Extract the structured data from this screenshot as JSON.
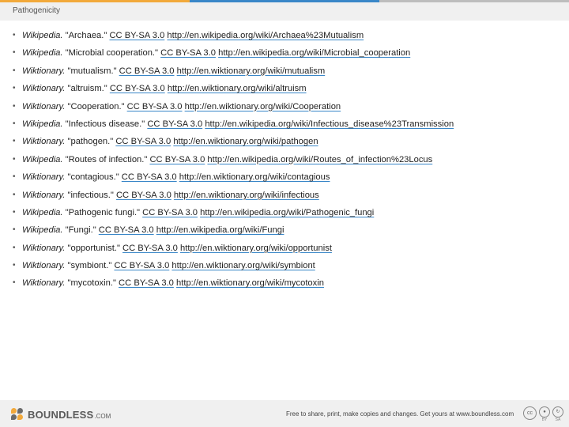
{
  "header": {
    "title": "Pathogenicity"
  },
  "references": [
    {
      "source": "Wikipedia.",
      "text": " \"Archaea.\" ",
      "license": "CC BY-SA 3.0",
      "url": "http://en.wikipedia.org/wiki/Archaea%23Mutualism"
    },
    {
      "source": "Wikipedia.",
      "text": " \"Microbial cooperation.\" ",
      "license": "CC BY-SA 3.0",
      "url": "http://en.wikipedia.org/wiki/Microbial_cooperation"
    },
    {
      "source": "Wiktionary.",
      "text": " \"mutualism.\" ",
      "license": "CC BY-SA 3.0",
      "url": "http://en.wiktionary.org/wiki/mutualism"
    },
    {
      "source": "Wiktionary.",
      "text": " \"altruism.\" ",
      "license": "CC BY-SA 3.0",
      "url": "http://en.wiktionary.org/wiki/altruism"
    },
    {
      "source": "Wiktionary.",
      "text": " \"Cooperation.\" ",
      "license": "CC BY-SA 3.0",
      "url": "http://en.wiktionary.org/wiki/Cooperation"
    },
    {
      "source": "Wikipedia.",
      "text": " \"Infectious disease.\" ",
      "license": "CC BY-SA 3.0",
      "url": "http://en.wikipedia.org/wiki/Infectious_disease%23Transmission"
    },
    {
      "source": "Wiktionary.",
      "text": " \"pathogen.\" ",
      "license": "CC BY-SA 3.0",
      "url": "http://en.wiktionary.org/wiki/pathogen"
    },
    {
      "source": "Wikipedia.",
      "text": " \"Routes of infection.\" ",
      "license": "CC BY-SA 3.0",
      "url": "http://en.wikipedia.org/wiki/Routes_of_infection%23Locus"
    },
    {
      "source": "Wiktionary.",
      "text": " \"contagious.\" ",
      "license": "CC BY-SA 3.0",
      "url": "http://en.wiktionary.org/wiki/contagious"
    },
    {
      "source": "Wiktionary.",
      "text": " \"infectious.\" ",
      "license": "CC BY-SA 3.0",
      "url": "http://en.wiktionary.org/wiki/infectious"
    },
    {
      "source": "Wikipedia.",
      "text": " \"Pathogenic fungi.\" ",
      "license": "CC BY-SA 3.0",
      "url": "http://en.wikipedia.org/wiki/Pathogenic_fungi"
    },
    {
      "source": "Wikipedia.",
      "text": " \"Fungi.\" ",
      "license": "CC BY-SA 3.0",
      "url": "http://en.wikipedia.org/wiki/Fungi"
    },
    {
      "source": "Wiktionary.",
      "text": " \"opportunist.\" ",
      "license": "CC BY-SA 3.0",
      "url": "http://en.wiktionary.org/wiki/opportunist"
    },
    {
      "source": "Wiktionary.",
      "text": " \"symbiont.\" ",
      "license": "CC BY-SA 3.0",
      "url": "http://en.wiktionary.org/wiki/symbiont"
    },
    {
      "source": "Wiktionary.",
      "text": " \"mycotoxin.\" ",
      "license": "CC BY-SA 3.0",
      "url": "http://en.wiktionary.org/wiki/mycotoxin"
    }
  ],
  "footer": {
    "logo_text": "BOUNDLESS",
    "logo_tld": ".COM",
    "note": "Free to share, print, make copies and changes. Get yours at www.boundless.com",
    "cc_labels": {
      "cc": "cc",
      "by": "BY",
      "sa": "SA"
    }
  },
  "colors": {
    "accent_orange": "#f2a93b",
    "accent_blue": "#3a87c8",
    "bar_gray": "#f0f0f0"
  }
}
